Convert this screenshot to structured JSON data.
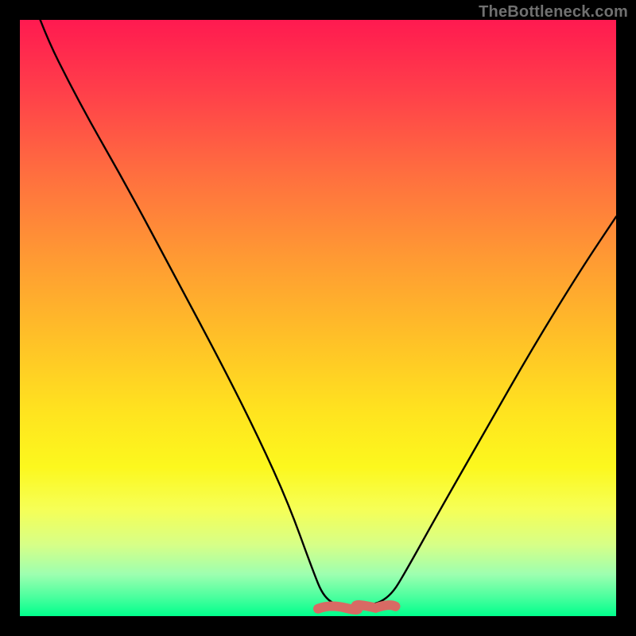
{
  "watermark": "TheBottleneck.com",
  "colors": {
    "frame": "#000000",
    "curve": "#000000",
    "plateau": "#d86a64",
    "gradient_top": "#ff1a50",
    "gradient_bottom": "#00ff8c"
  },
  "chart_data": {
    "type": "line",
    "title": "",
    "xlabel": "",
    "ylabel": "",
    "xlim": [
      0,
      100
    ],
    "ylim": [
      0,
      100
    ],
    "note": "No numeric axis ticks are displayed; x and y are normalized 0–100. Curve represents a V-shaped metric reaching ~0 between x≈51 and x≈62, with a short flat plateau highlighted in red near the minimum.",
    "series": [
      {
        "name": "curve",
        "x": [
          0,
          3,
          10,
          18,
          26,
          34,
          40,
          45,
          49,
          51,
          54,
          58,
          62,
          65,
          70,
          78,
          86,
          94,
          100
        ],
        "y": [
          110,
          100,
          86,
          72,
          57,
          42,
          30,
          19,
          8,
          3,
          1.5,
          1.5,
          3,
          8,
          17,
          31,
          45,
          58,
          67
        ]
      }
    ],
    "annotations": [
      {
        "name": "plateau",
        "x_range": [
          50,
          63
        ],
        "y": 1.5,
        "color": "#d86a64"
      }
    ]
  }
}
